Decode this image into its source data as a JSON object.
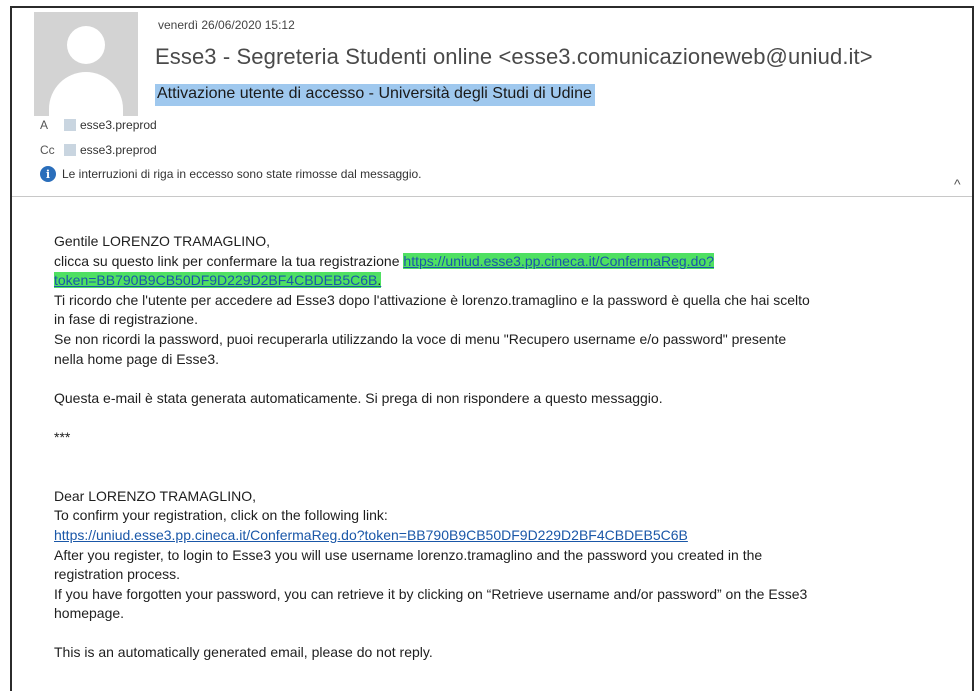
{
  "header": {
    "date": "venerdì 26/06/2020 15:12",
    "sender": "Esse3 - Segreteria Studenti online <esse3.comunicazioneweb@uniud.it>",
    "subject": "Attivazione utente di accesso - Università degli Studi di Udine"
  },
  "recipients": {
    "to_label": "A",
    "to_value": "esse3.preprod",
    "cc_label": "Cc",
    "cc_value": "esse3.preprod"
  },
  "info_bar": {
    "icon": "info-icon",
    "text": "Le interruzioni di riga in eccesso sono state rimosse dal messaggio."
  },
  "collapse_icon": "^",
  "message_it": {
    "greeting": "Gentile LORENZO TRAMAGLINO,",
    "line1_prefix": "clicca su questo link per confermare la tua registrazione ",
    "link_part1": "https://uniud.esse3.pp.cineca.it/ConfermaReg.do?",
    "link_part2": "token=BB790B9CB50DF9D229D2BF4CBDEB5C6B",
    "link_suffix": ".",
    "line3": "Ti ricordo che l'utente per accedere ad Esse3 dopo l'attivazione è  lorenzo.tramaglino e la password è quella che hai scelto",
    "line4": "in fase di registrazione.",
    "line5": "Se non ricordi la password, puoi recuperarla utilizzando la voce di menu \"Recupero username e/o password\" presente",
    "line6": "nella home page di Esse3.",
    "auto": "Questa e-mail è stata generata automaticamente. Si prega di non rispondere a questo messaggio.",
    "separator": "***"
  },
  "message_en": {
    "greeting": "Dear LORENZO TRAMAGLINO,",
    "line1": "To confirm your registration, click on the following link:",
    "link": "https://uniud.esse3.pp.cineca.it/ConfermaReg.do?token=BB790B9CB50DF9D229D2BF4CBDEB5C6B",
    "line3": "After you register, to login to Esse3 you will use username  lorenzo.tramaglino  and the password you created in the",
    "line4": "registration process.",
    "line5": "If you have forgotten your password, you can retrieve it by clicking on “Retrieve username and/or password” on the Esse3",
    "line6": "homepage.",
    "auto": "This is an automatically generated email, please do not reply."
  },
  "colors": {
    "subject_highlight": "#9fc8ee",
    "link_highlight": "#4fe062",
    "link": "#1a57a8"
  }
}
